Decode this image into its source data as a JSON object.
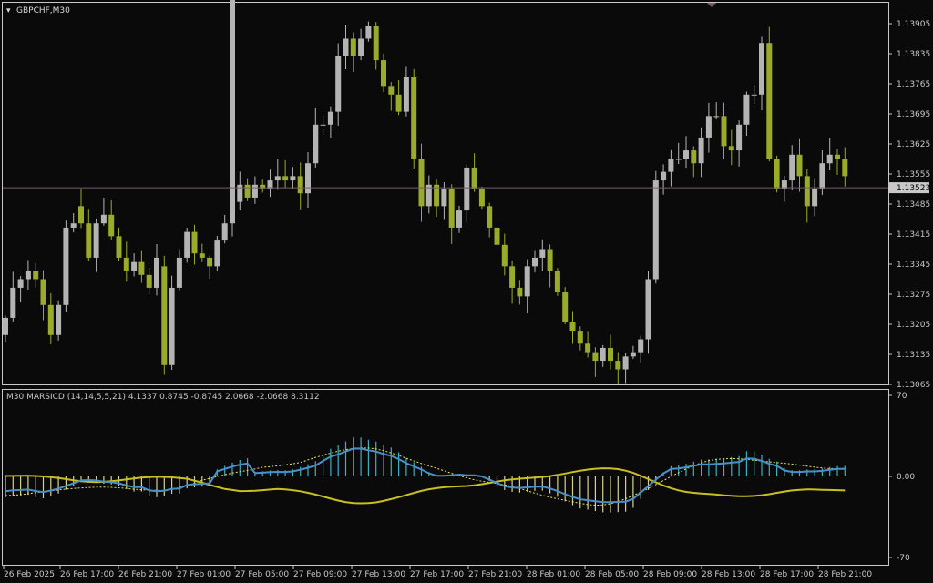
{
  "window": {
    "symbol_label": "GBPCHF,M30",
    "menu_arrow_icon": "triangle-down-icon"
  },
  "colors": {
    "background": "#0a0a0a",
    "grid_frame": "#c8c8c8",
    "bull": "#b4b4b4",
    "bear": "#9aaa2a",
    "current_price_line": "#7a5a6a",
    "current_price_box": "#c8c8c8",
    "indicator_blue": "#4a8fc8",
    "indicator_yellow": "#c8c020",
    "hist_positive": "#3ab0c0",
    "hist_negative": "#d8d090",
    "signal_dashed": "#e8e060"
  },
  "chart_data": [
    {
      "type": "candlestick",
      "title": "GBPCHF,M30",
      "current_price": 1.13523,
      "ylim": [
        1.13065,
        1.13905
      ],
      "y_ticks": [
        "1.13905",
        "1.13835",
        "1.13765",
        "1.13695",
        "1.13625",
        "1.13555",
        "1.13485",
        "1.13415",
        "1.13345",
        "1.13275",
        "1.13205",
        "1.13135",
        "1.13065"
      ],
      "x_ticks": [
        "26 Feb 2025",
        "26 Feb 17:00",
        "26 Feb 21:00",
        "27 Feb 01:00",
        "27 Feb 05:00",
        "27 Feb 09:00",
        "27 Feb 13:00",
        "27 Feb 17:00",
        "27 Feb 21:00",
        "28 Feb 01:00",
        "28 Feb 05:00",
        "28 Feb 09:00",
        "28 Feb 13:00",
        "28 Feb 17:00",
        "28 Feb 21:00"
      ],
      "close": [
        1.1322,
        1.1329,
        1.1331,
        1.1333,
        1.1331,
        1.1325,
        1.1318,
        1.1325,
        1.1343,
        1.1344,
        1.1344,
        1.1336,
        1.1344,
        1.1346,
        1.1341,
        1.1336,
        1.1333,
        1.1335,
        1.1332,
        1.1329,
        1.1336,
        1.1311,
        1.1329,
        1.1336,
        1.1342,
        1.1337,
        1.1336,
        1.1334,
        1.134,
        1.1344,
        1.1449,
        1.1353,
        1.135,
        1.1353,
        1.1352,
        1.1354,
        1.1355,
        1.1354,
        1.1355,
        1.1351,
        1.1358,
        1.1367,
        1.1367,
        1.137,
        1.1383,
        1.1387,
        1.1383,
        1.1387,
        1.139,
        1.1382,
        1.1376,
        1.1374,
        1.137,
        1.1378,
        1.1359,
        1.1348,
        1.1353,
        1.1348,
        1.1352,
        1.1343,
        1.1347,
        1.1357,
        1.1352,
        1.1348,
        1.1343,
        1.1339,
        1.1334,
        1.1329,
        1.1327,
        1.1334,
        1.1336,
        1.1338,
        1.1333,
        1.1328,
        1.1321,
        1.1319,
        1.1316,
        1.1314,
        1.1312,
        1.1315,
        1.1312,
        1.131,
        1.1313,
        1.1314,
        1.1317,
        1.1331,
        1.1354,
        1.1356,
        1.1359,
        1.1359,
        1.1361,
        1.1358,
        1.1364,
        1.1369,
        1.1369,
        1.1362,
        1.1361,
        1.1367,
        1.1374,
        1.1374,
        1.1386,
        1.1359,
        1.1352,
        1.1354,
        1.136,
        1.1355,
        1.1348,
        1.1352,
        1.1358,
        1.136,
        1.1359,
        1.1355
      ],
      "open": [
        1.1318,
        1.1322,
        1.1329,
        1.1331,
        1.1333,
        1.1331,
        1.1325,
        1.1318,
        1.1325,
        1.1343,
        1.1348,
        1.1344,
        1.1336,
        1.1344,
        1.1346,
        1.1341,
        1.1336,
        1.1333,
        1.1335,
        1.1332,
        1.1329,
        1.1334,
        1.1311,
        1.1329,
        1.1336,
        1.1342,
        1.1337,
        1.1336,
        1.1334,
        1.134,
        1.1344,
        1.1349,
        1.1353,
        1.135,
        1.1353,
        1.1352,
        1.1354,
        1.1355,
        1.1354,
        1.1355,
        1.1351,
        1.1358,
        1.1367,
        1.1367,
        1.137,
        1.1383,
        1.1387,
        1.1383,
        1.1387,
        1.139,
        1.1382,
        1.1376,
        1.1374,
        1.137,
        1.1378,
        1.1359,
        1.1348,
        1.1353,
        1.1348,
        1.1352,
        1.1343,
        1.1347,
        1.1357,
        1.1352,
        1.1348,
        1.1343,
        1.1339,
        1.1334,
        1.1329,
        1.1327,
        1.1334,
        1.1336,
        1.1338,
        1.1333,
        1.1328,
        1.1321,
        1.1319,
        1.1316,
        1.1314,
        1.1312,
        1.1315,
        1.1312,
        1.131,
        1.1313,
        1.1314,
        1.1317,
        1.1331,
        1.1354,
        1.1356,
        1.1359,
        1.1359,
        1.1361,
        1.1358,
        1.1364,
        1.1369,
        1.1369,
        1.1362,
        1.1361,
        1.1367,
        1.1374,
        1.1374,
        1.1386,
        1.1359,
        1.1352,
        1.1354,
        1.136,
        1.1355,
        1.1348,
        1.1352,
        1.1358,
        1.136,
        1.1359
      ]
    },
    {
      "type": "oscillator",
      "title": "M30 MARSICD (14,14,5,5,21) 4.1337 0.8745 -0.8745 2.0668 -2.0668 8.3112",
      "ylim": [
        -70,
        70
      ],
      "y_ticks": [
        "70",
        "0.00",
        "-70"
      ]
    }
  ]
}
